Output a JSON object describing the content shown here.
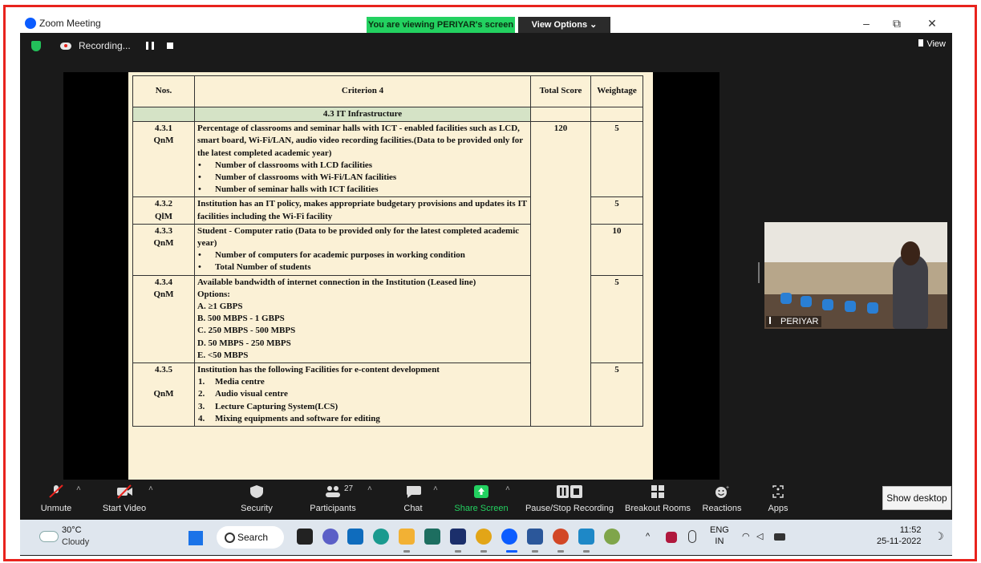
{
  "window": {
    "title": "Zoom Meeting"
  },
  "banner": {
    "viewing": "You are viewing PERIYAR's screen",
    "view_options": "View Options ⌄"
  },
  "window_controls": {
    "minimize": "–",
    "restore": "⧉",
    "close": "✕"
  },
  "recording": {
    "label": "Recording..."
  },
  "view_button": "View",
  "slide": {
    "headers": [
      "Nos.",
      "Criterion 4",
      "Total Score",
      "Weightage"
    ],
    "section": "4.3 IT Infrastructure",
    "total_score": "120",
    "rows": [
      {
        "num": "4.3.1",
        "type": "QnM",
        "weight": "5",
        "text": "Percentage of classrooms and seminar halls with ICT - enabled facilities such as LCD, smart board, Wi-Fi/LAN, audio video recording facilities.(Data to be provided only for the latest completed academic year)",
        "bullets": [
          "Number of classrooms with LCD facilities",
          "Number of classrooms with Wi-Fi/LAN facilities",
          "Number of seminar halls with ICT facilities"
        ]
      },
      {
        "num": "4.3.2",
        "type": "QlM",
        "weight": "5",
        "text": "Institution has an IT policy, makes appropriate budgetary provisions and updates its IT facilities including the Wi-Fi facility"
      },
      {
        "num": "4.3.3",
        "type": "QnM",
        "weight": "10",
        "text": "Student - Computer ratio (Data to be provided only for the latest completed academic year)",
        "bullets": [
          "Number of computers for academic purposes in working condition",
          "Total Number of students"
        ]
      },
      {
        "num": "4.3.4",
        "type": "QnM",
        "weight": "5",
        "text": "Available bandwidth of internet connection in the Institution (Leased line)",
        "options_label": "Options:",
        "options": [
          "A. ≥1 GBPS",
          "B. 500 MBPS - 1 GBPS",
          "C. 250 MBPS - 500 MBPS",
          "D. 50 MBPS - 250 MBPS",
          "E. <50 MBPS"
        ]
      },
      {
        "num": "4.3.5",
        "type": "QnM",
        "weight": "5",
        "text": "Institution has the following Facilities for e-content development",
        "numbered": [
          [
            "1.",
            "Media centre"
          ],
          [
            "2.",
            "Audio visual centre"
          ],
          [
            "3.",
            "Lecture Capturing System(LCS)"
          ],
          [
            "4.",
            "Mixing equipments and software for editing"
          ]
        ]
      }
    ]
  },
  "participant_tile": {
    "name": "PERIYAR"
  },
  "toolbar": {
    "unmute": "Unmute",
    "start_video": "Start Video",
    "security": "Security",
    "participants": "Participants",
    "participants_count": "27",
    "chat": "Chat",
    "share_screen": "Share Screen",
    "pause_stop_recording": "Pause/Stop Recording",
    "breakout_rooms": "Breakout Rooms",
    "reactions": "Reactions",
    "apps": "Apps",
    "chevron": "˄"
  },
  "show_desktop": "Show desktop",
  "taskbar": {
    "temperature": "30°C",
    "condition": "Cloudy",
    "search": "Search",
    "lang_top": "ENG",
    "lang_bottom": "IN",
    "time": "11:52",
    "date": "25-11-2022",
    "tray_chevron": "^"
  },
  "colors": {
    "accent_green": "#23d160",
    "zoom_blue": "#0b5cff",
    "frame_red": "#e8231d",
    "section_green": "#d5e3c6",
    "slide_bg": "#fbf1d6"
  }
}
